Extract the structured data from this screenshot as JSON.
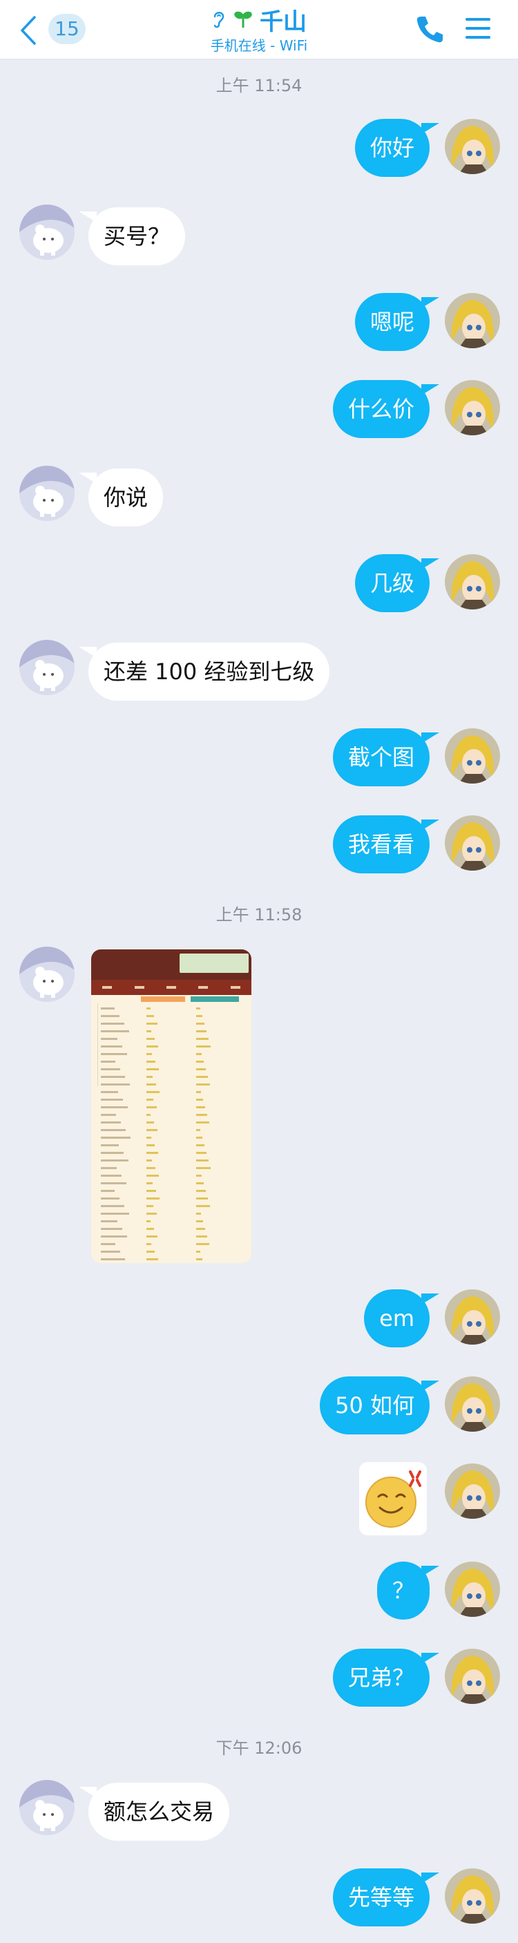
{
  "header": {
    "unread_count": "15",
    "contact_name": "千山",
    "status": "手机在线 - WiFi",
    "accent_color": "#1d9be8"
  },
  "icons": {
    "back": "chevron-left-icon",
    "ear": "ear-icon",
    "sprout": "sprout-icon",
    "call": "phone-icon",
    "menu": "hamburger-menu-icon"
  },
  "timestamps": [
    "上午 11:54",
    "上午 11:58",
    "下午 12:06"
  ],
  "messages": [
    {
      "side": "out",
      "text": "你好"
    },
    {
      "side": "in",
      "text": "买号？"
    },
    {
      "side": "out",
      "text": "嗯呢"
    },
    {
      "side": "out",
      "text": "什么价"
    },
    {
      "side": "in",
      "text": "你说"
    },
    {
      "side": "out",
      "text": "几级"
    },
    {
      "side": "in",
      "text": "还差 100 经验到七级"
    },
    {
      "side": "out",
      "text": "截个图"
    },
    {
      "side": "out",
      "text": "我看看"
    },
    {
      "side": "in",
      "type": "image",
      "text": ""
    },
    {
      "side": "out",
      "text": "em"
    },
    {
      "side": "out",
      "text": "50 如何"
    },
    {
      "side": "out",
      "type": "sticker",
      "text": ""
    },
    {
      "side": "out",
      "text": "？"
    },
    {
      "side": "out",
      "text": "兄弟？"
    },
    {
      "side": "in",
      "text": "额怎么交易"
    },
    {
      "side": "out",
      "text": "先等等"
    }
  ],
  "colors": {
    "background": "#eaedf4",
    "outgoing_bubble": "#12b7f5",
    "incoming_bubble": "#ffffff"
  }
}
